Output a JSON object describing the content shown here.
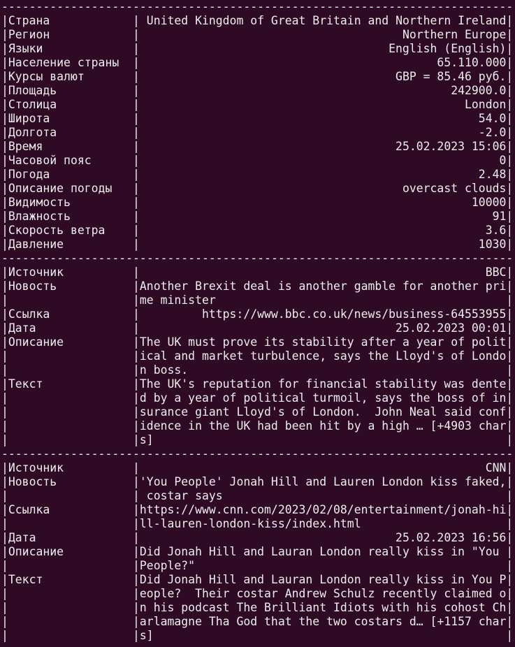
{
  "separator": "--------------------------------------------------------------------------",
  "pipe": "|",
  "sections": [
    {
      "name": "country-info",
      "rows": [
        {
          "label": "Страна",
          "lines": [
            " United Kingdom of Great Britain and Northern Ireland"
          ]
        },
        {
          "label": "Регион",
          "lines": [
            "Northern Europe"
          ]
        },
        {
          "label": "Языки",
          "lines": [
            "English (English)"
          ]
        },
        {
          "label": "Население страны",
          "lines": [
            "65.110.000"
          ]
        },
        {
          "label": "Курсы валют",
          "lines": [
            "GBP = 85.46 руб."
          ]
        },
        {
          "label": "Площадь",
          "lines": [
            "242900.0"
          ]
        },
        {
          "label": "Столица",
          "lines": [
            "London"
          ]
        },
        {
          "label": "Широта",
          "lines": [
            "54.0"
          ]
        },
        {
          "label": "Долгота",
          "lines": [
            "-2.0"
          ]
        },
        {
          "label": "Время",
          "lines": [
            "25.02.2023 15:06"
          ]
        },
        {
          "label": "Часовой пояс",
          "lines": [
            "0"
          ]
        },
        {
          "label": "Погода",
          "lines": [
            "2.48"
          ]
        },
        {
          "label": "Описание погоды",
          "lines": [
            "overcast clouds"
          ]
        },
        {
          "label": "Видимость",
          "lines": [
            "10000"
          ]
        },
        {
          "label": "Влажность",
          "lines": [
            "91"
          ]
        },
        {
          "label": "Скорость ветра",
          "lines": [
            "3.6"
          ]
        },
        {
          "label": "Давление",
          "lines": [
            "1030"
          ]
        }
      ]
    },
    {
      "name": "news-bbc",
      "rows": [
        {
          "label": "Источник",
          "lines": [
            "BBC"
          ]
        },
        {
          "label": "Новость",
          "lines": [
            "Another Brexit deal is another gamble for another pri",
            "me minister"
          ]
        },
        {
          "label": "Ссылка",
          "lines": [
            "https://www.bbc.co.uk/news/business-64553955"
          ]
        },
        {
          "label": "Дата",
          "lines": [
            "25.02.2023 00:01"
          ]
        },
        {
          "label": "Описание",
          "lines": [
            "The UK must prove its stability after a year of polit",
            "ical and market turbulence, says the Lloyd's of Londo",
            "n boss."
          ]
        },
        {
          "label": "Текст",
          "lines": [
            "The UK's reputation for financial stability was dente",
            "d by a year of political turmoil, says the boss of in",
            "surance giant Lloyd's of London.  John Neal said conf",
            "idence in the UK had been hit by a high … [+4903 char",
            "s]"
          ]
        }
      ]
    },
    {
      "name": "news-cnn",
      "rows": [
        {
          "label": "Источник",
          "lines": [
            "CNN"
          ]
        },
        {
          "label": "Новость",
          "lines": [
            "'You People' Jonah Hill and Lauren London kiss faked,",
            " costar says"
          ]
        },
        {
          "label": "Ссылка",
          "lines": [
            "https://www.cnn.com/2023/02/08/entertainment/jonah-hi",
            "ll-lauren-london-kiss/index.html"
          ]
        },
        {
          "label": "Дата",
          "lines": [
            "25.02.2023 16:56"
          ]
        },
        {
          "label": "Описание",
          "lines": [
            "Did Jonah Hill and Lauran London really kiss in \"You ",
            "People?\""
          ]
        },
        {
          "label": "Текст",
          "lines": [
            "Did Jonah Hill and Lauran London really kiss in You P",
            "eople?  Their costar Andrew Schulz recently claimed o",
            "n his podcast The Brilliant Idiots with his cohost Ch",
            "arlamagne Tha God that the two costars d… [+1157 char",
            "s]"
          ]
        }
      ]
    }
  ]
}
